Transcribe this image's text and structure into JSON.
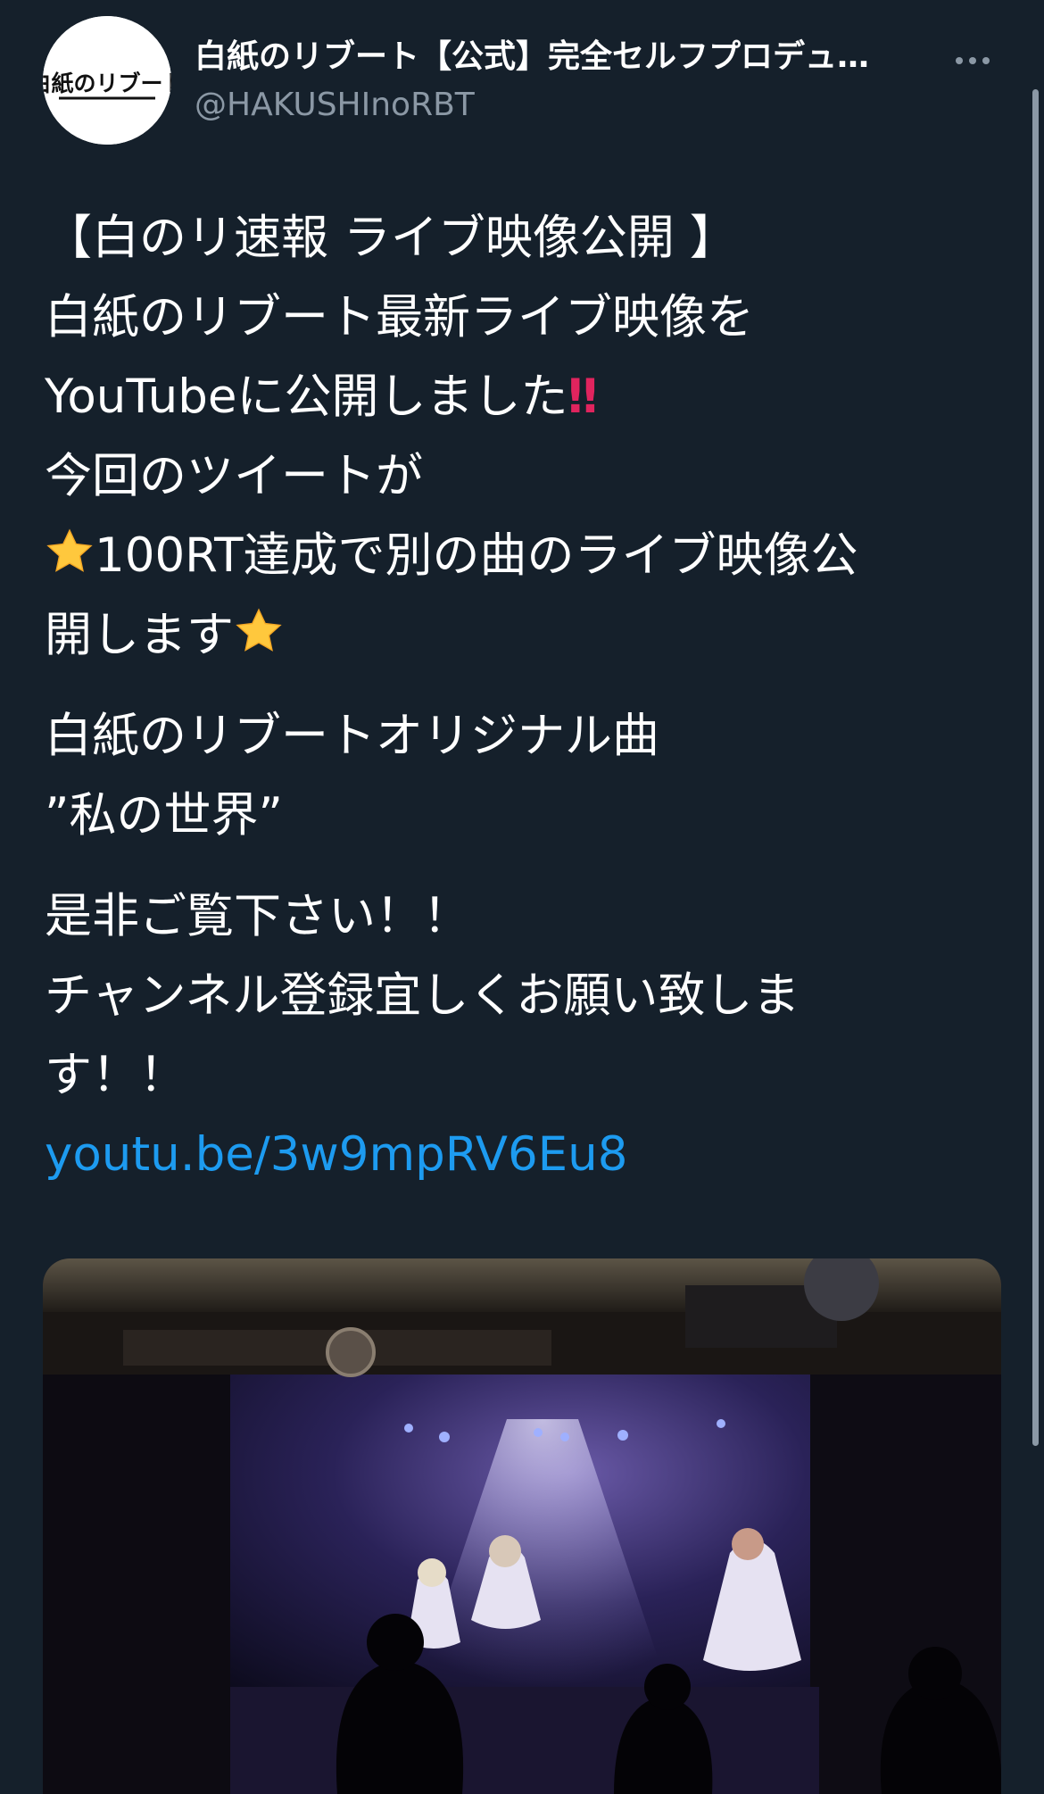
{
  "author": {
    "display_name": "白紙のリブート【公式】完全セルフプロデュ…",
    "handle": "@HAKUSHInoRBT",
    "avatar_logo_text": "白紙のリブート"
  },
  "tweet": {
    "lines": [
      "【白のリ速報 ライブ映像公開 】",
      "白紙のリブート最新ライブ映像を",
      "YouTubeに公開しました",
      "今回のツイートが",
      "100RT達成で別の曲のライブ映像公",
      "開します",
      "白紙のリブートオリジナル曲",
      "”私の世界”",
      "是非ご覧下さい！！",
      "チャンネル登録宜しくお願い致しま",
      "す！！"
    ],
    "exclaim_emoji": "‼",
    "link_text": "youtu.be/3w9mpRV6Eu8"
  },
  "media": {
    "description_icon": "video-thumbnail-image"
  },
  "colors": {
    "background": "#15202b",
    "text": "#ffffff",
    "secondary_text": "#8b98a5",
    "link": "#1d9bf0",
    "exclaim": "#e0245e",
    "star": "#ffc83d"
  }
}
